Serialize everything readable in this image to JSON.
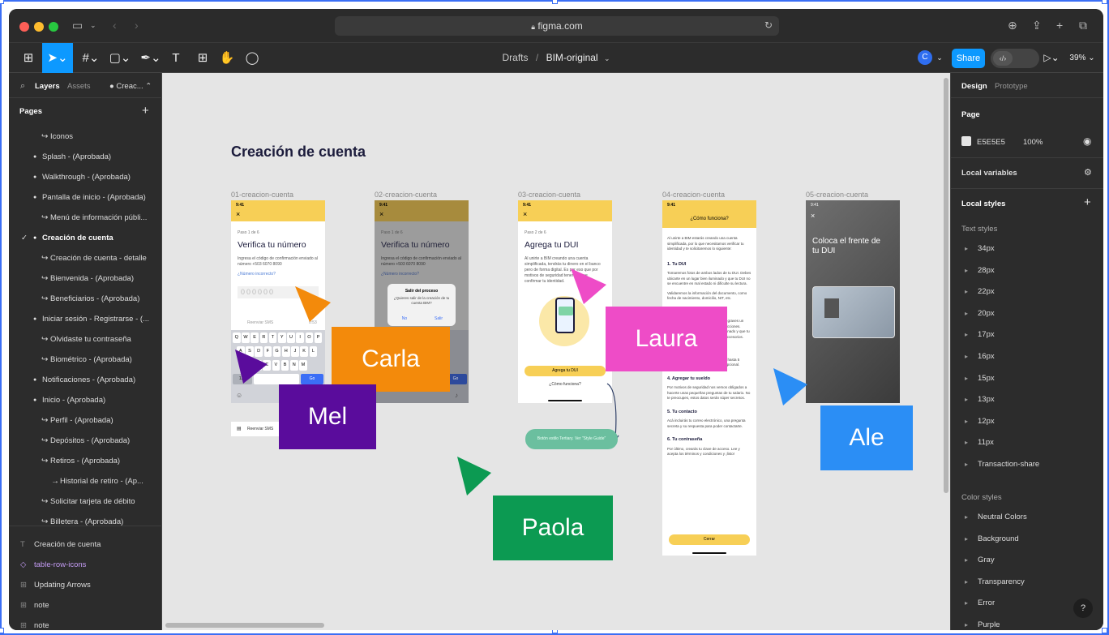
{
  "browser": {
    "url": "figma.com"
  },
  "toolbar": {
    "breadcrumb_root": "Drafts",
    "breadcrumb_sep": "/",
    "file_name": "BIM-original",
    "avatar_initial": "C",
    "share_label": "Share",
    "zoom": "39%"
  },
  "left_panel": {
    "tab_layers": "Layers",
    "tab_assets": "Assets",
    "page_selector": "Creac...",
    "pages_header": "Pages",
    "pages": [
      {
        "label": "Iconos",
        "prefix": "↪"
      },
      {
        "label": "Splash - (Aprobada)",
        "prefix": "●"
      },
      {
        "label": "Walkthrough - (Aprobada)",
        "prefix": "●"
      },
      {
        "label": "Pantalla de inicio - (Aprobada)",
        "prefix": "●"
      },
      {
        "label": "Menú de información públi...",
        "prefix": "↪"
      },
      {
        "label": "Creación de cuenta",
        "prefix": "●"
      },
      {
        "label": "Creación de cuenta - detalle",
        "prefix": "↪"
      },
      {
        "label": "Bienvenida - (Aprobada)",
        "prefix": "↪"
      },
      {
        "label": "Beneficiarios - (Aprobada)",
        "prefix": "↪"
      },
      {
        "label": "Iniciar sesión - Registrarse - (...",
        "prefix": "●"
      },
      {
        "label": "Olvidaste tu contraseña",
        "prefix": "↪"
      },
      {
        "label": "Biométrico - (Aprobada)",
        "prefix": "↪"
      },
      {
        "label": "Notificaciones - (Aprobada)",
        "prefix": "●"
      },
      {
        "label": "Inicio - (Aprobada)",
        "prefix": "●"
      },
      {
        "label": "Perfil - (Aprobada)",
        "prefix": "↪"
      },
      {
        "label": "Depósitos - (Aprobada)",
        "prefix": "↪"
      },
      {
        "label": "Retiros - (Aprobada)",
        "prefix": "↪"
      },
      {
        "label": "Historial de retiro  - (Ap...",
        "prefix": "→"
      },
      {
        "label": "Solicitar tarjeta de débito",
        "prefix": "↪"
      },
      {
        "label": "Billetera - (Aprobada)",
        "prefix": "↪"
      }
    ],
    "layers": [
      {
        "label": "Creación de cuenta",
        "icon": "T"
      },
      {
        "label": "table-row-icons",
        "icon": "◇"
      },
      {
        "label": "Updating Arrows",
        "icon": "⊞"
      },
      {
        "label": "note",
        "icon": "⊞"
      },
      {
        "label": "note",
        "icon": "⊞"
      }
    ]
  },
  "canvas": {
    "section_title": "Creación de cuenta",
    "frames": [
      "01-creacion-cuenta",
      "02-creacion-cuenta",
      "03-creacion-cuenta",
      "04-creacion-cuenta",
      "05-creacion-cuenta"
    ],
    "status_time": "9:41",
    "close_mark": "×",
    "phone1": {
      "step": "Paso 1 de 6",
      "title": "Verifica tu número",
      "body": "Ingresa el código de confirmación enviado al número +503 6070 8090",
      "link": "¿Número incorrecto?",
      "code": "000000",
      "resend": "Reenviar SMS",
      "timer": "0:53",
      "keys_row1": [
        "Q",
        "W",
        "E",
        "R",
        "T",
        "Y",
        "U",
        "I",
        "O",
        "P"
      ],
      "keys_row2": [
        "A",
        "S",
        "D",
        "F",
        "G",
        "H",
        "J",
        "K",
        "L"
      ],
      "keys_row3": [
        "Z",
        "X",
        "C",
        "V",
        "B",
        "N",
        "M"
      ],
      "key_num": "123",
      "key_go": "Go"
    },
    "phone2": {
      "step": "Paso 1 de 6",
      "title": "Verifica tu número",
      "body": "Ingresa el código de confirmación enviado al número +503 6070 8090",
      "link": "¿Número incorrecto?",
      "dialog_title": "Salir del proceso",
      "dialog_body": "¿Quieres salir de la creación de tu cuenta BIM?",
      "dialog_no": "No",
      "dialog_yes": "Salir"
    },
    "phone3": {
      "step": "Paso 2 de 6",
      "title": "Agrega tu DUI",
      "body": "Al unirte a BIM creando una cuenta simplificada, tendrás tu dinero en el banco pero de forma digital. Es por eso que por motivos de seguridad tenemos que confirmar tu identidad.",
      "button": "Agrega tu DUI",
      "link": "¿Cómo funciona?"
    },
    "note_button": "Botón estilo Tertiary. Ver \"Style Guide\"",
    "reenviar_snippet": "Reenviar SMS",
    "phone4": {
      "header": "¿Cómo funciona?",
      "intro": "Al unirte a BIM estarás creando una cuenta simplificada, por lo que necesitamos verificar tu identidad y te solicitaremos lo siguiente:",
      "s1_title": "1. Tu DUI",
      "s1_body": "Tomaremos fotos de ambos lados de tu DUI. Debes ubicarte en un lugar bien iluminado y que tu DUI no se encuentre en mal estado ni dificulte su lectura.",
      "s1_body2": "Validaremos la información del documento, como fecha de nacimiento, domicilio, NIT, etc.",
      "s2_title": "2. Tu identidad",
      "s2_body": "Te pediremos que tomes una selfie y graves un video corto mientras sigues las instrucciones. Debes ubicarte en un lugar bien iluminado y que tu rostro no se encuentre cubierto por accesorios.",
      "s3_title": "3. Tus beneficiarios",
      "s3_body": "BIM te brinda la posibilidad de incluir hasta 5 personas a tu cuenta, este paso es opcional.",
      "s4_title": "4. Agregar tu sueldo",
      "s4_body": "Por motivos de seguridad nos vemos obligados a hacerte unas pequeñas preguntas de tu salario. No te preocupes, estos datos serán súper secretos.",
      "s5_title": "5. Tu contacto",
      "s5_body": "Acá incluirás tu correo electrónico, una pregunta secreta y su respuesta para poder contactarte.",
      "s6_title": "6. Tu contraseña",
      "s6_body": "Por último, crearás tu clave de acceso. Lee y acepta los términos y condiciones y ¡listo!",
      "button": "Cerrar"
    },
    "phone5": {
      "title": "Coloca el frente de tu DUI"
    },
    "cursors": [
      {
        "name": "Carla",
        "color": "#f38a0b"
      },
      {
        "name": "Mel",
        "color": "#5a0c9c"
      },
      {
        "name": "Laura",
        "color": "#ee4cc7"
      },
      {
        "name": "Paola",
        "color": "#0c9a52"
      },
      {
        "name": "Ale",
        "color": "#2b8ef5"
      }
    ]
  },
  "right_panel": {
    "tab_design": "Design",
    "tab_prototype": "Prototype",
    "page_header": "Page",
    "page_color": "E5E5E5",
    "page_opacity": "100%",
    "local_variables": "Local variables",
    "local_styles": "Local styles",
    "text_styles_header": "Text styles",
    "text_styles": [
      "34px",
      "28px",
      "22px",
      "20px",
      "17px",
      "16px",
      "15px",
      "13px",
      "12px",
      "11px",
      "Transaction-share"
    ],
    "color_styles_header": "Color styles",
    "color_styles": [
      "Neutral Colors",
      "Background",
      "Gray",
      "Transparency",
      "Error",
      "Purple"
    ],
    "help": "?"
  },
  "colors": {
    "accent": "#0d99ff",
    "brand_yellow": "#f7cf56",
    "canvas_bg": "#e5e5e5"
  }
}
